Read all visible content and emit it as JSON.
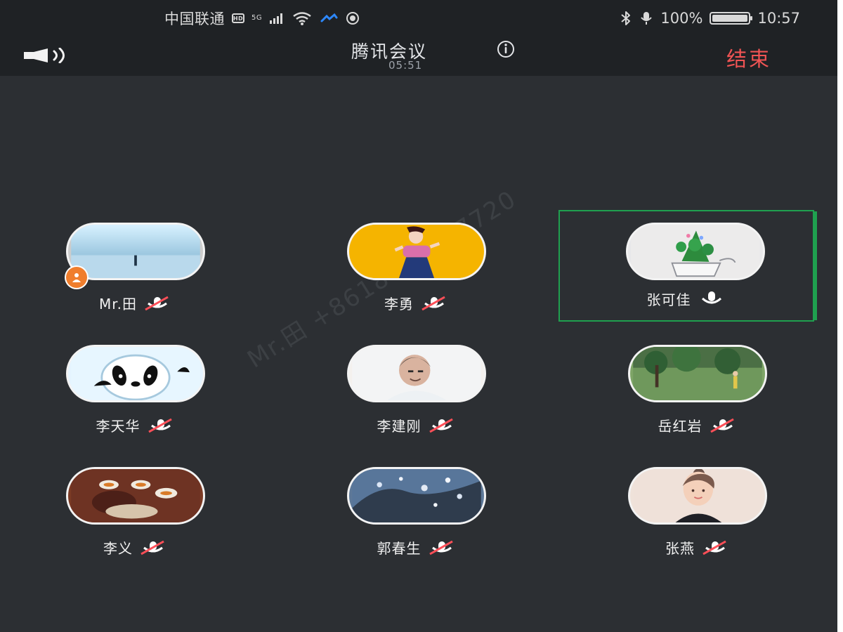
{
  "status_bar": {
    "carrier": "中国联通",
    "carrier_badge": "HD",
    "network_mini": "5G",
    "battery_text": "100%",
    "battery_level": 1.0,
    "time": "10:57",
    "icons": [
      "signal-icon",
      "wifi-icon",
      "bluetooth-icon",
      "mic-status-icon",
      "battery-icon"
    ]
  },
  "meeting": {
    "title": "腾讯会议",
    "timer": "05:51",
    "end_label": "结束"
  },
  "watermark": {
    "text": "Mr.田 +8618688827720"
  },
  "participants": [
    {
      "name": "Mr.田",
      "mic": "muted",
      "host": true
    },
    {
      "name": "李勇",
      "mic": "muted",
      "host": false
    },
    {
      "name": "张可佳",
      "mic": "active",
      "host": false
    },
    {
      "name": "李天华",
      "mic": "muted",
      "host": false
    },
    {
      "name": "李建刚",
      "mic": "muted",
      "host": false
    },
    {
      "name": "岳红岩",
      "mic": "muted",
      "host": false
    },
    {
      "name": "李义",
      "mic": "muted",
      "host": false
    },
    {
      "name": "郭春生",
      "mic": "muted",
      "host": false
    },
    {
      "name": "张燕",
      "mic": "muted",
      "host": false
    }
  ],
  "colors": {
    "background": "#2c2f33",
    "topbar": "#1f2225",
    "end": "#f05454",
    "active": "#1fa04f",
    "host_badge": "#f07e2d"
  }
}
